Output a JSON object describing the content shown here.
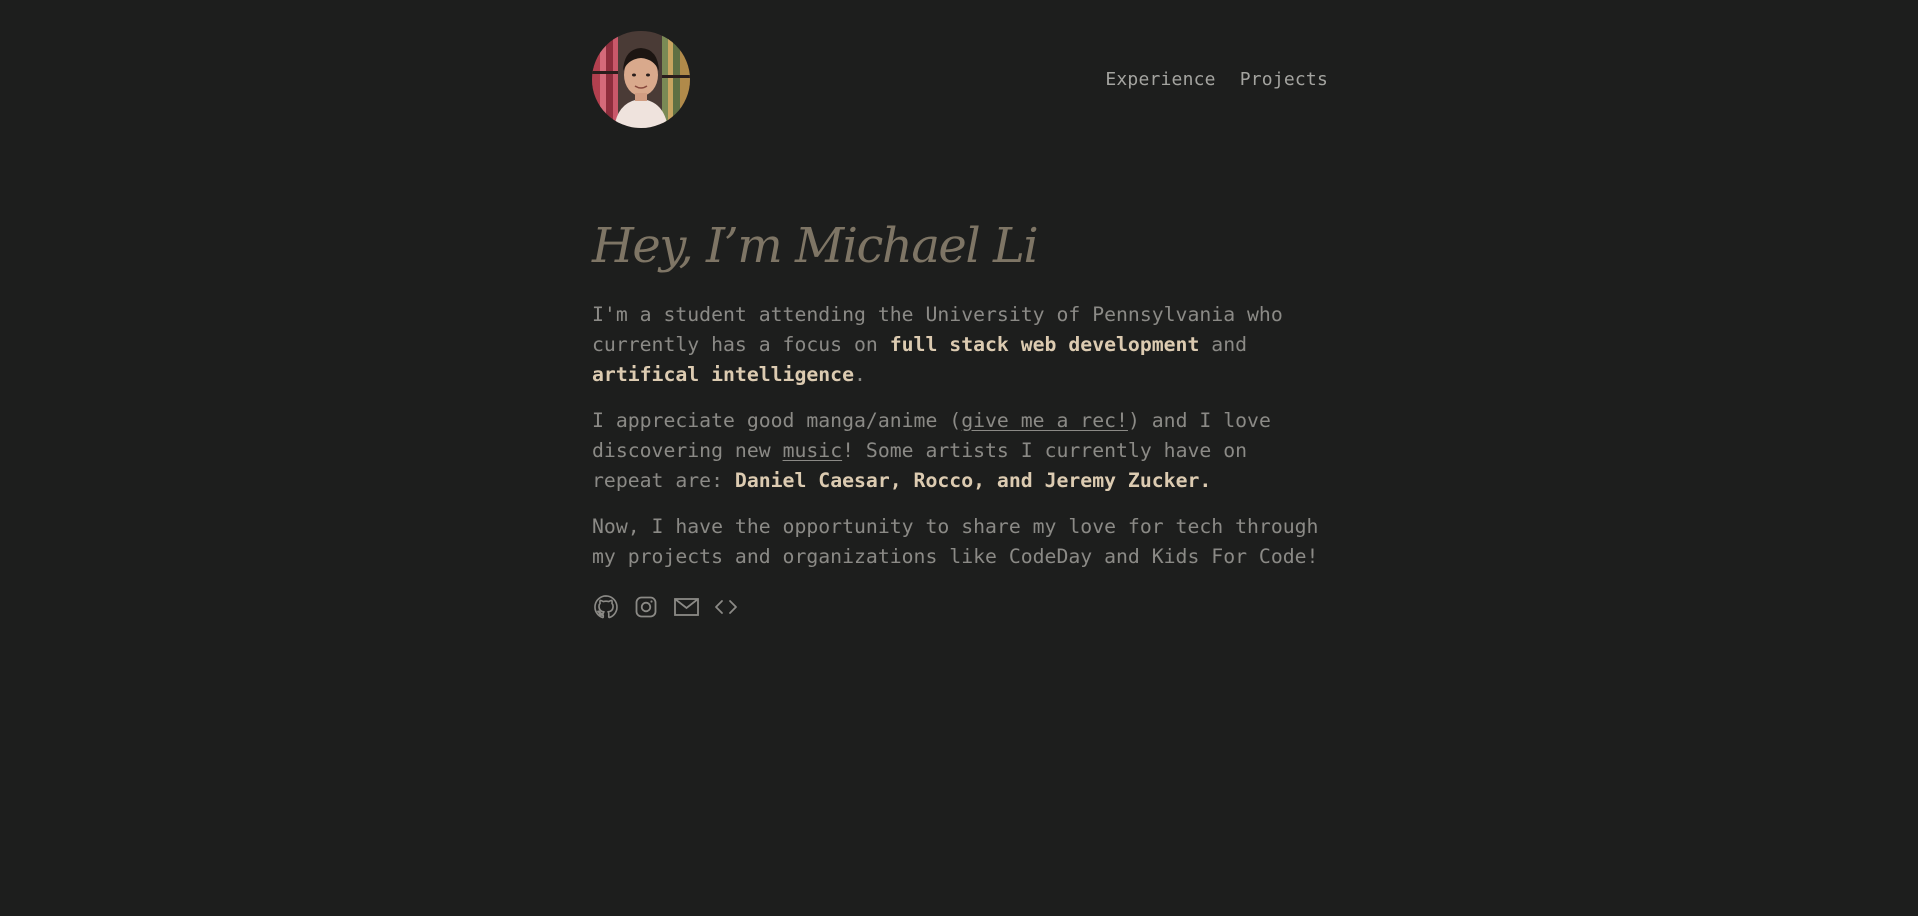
{
  "nav": {
    "experience": "Experience",
    "projects": "Projects"
  },
  "hero": {
    "title": "Hey, I’m Michael Li"
  },
  "about": {
    "p1_a": "I'm a student attending the University of Pennsylvania who currently has a focus on ",
    "p1_hl1": "full stack web development",
    "p1_b": " and ",
    "p1_hl2": "artifical intelligence",
    "p1_c": ".",
    "p2_a": "I appreciate good manga/anime (",
    "p2_link1": "give me a rec!",
    "p2_b": ") and I love discovering new ",
    "p2_link2": "music",
    "p2_c": "! Some artists I currently have on repeat are: ",
    "p2_hl": "Daniel Caesar, Rocco, and Jeremy Zucker.",
    "p3": "Now, I have the opportunity to share my love for tech through my projects and organizations like CodeDay and Kids For Code!"
  },
  "socials": [
    {
      "icon": "github-icon"
    },
    {
      "icon": "instagram-icon"
    },
    {
      "icon": "mail-icon"
    },
    {
      "icon": "code-icon"
    }
  ],
  "colors": {
    "background": "#1d1e1d",
    "text": "#8b8a86",
    "highlight": "#dccbb1",
    "title": "#7e7565",
    "nav": "#a4a4a0"
  }
}
